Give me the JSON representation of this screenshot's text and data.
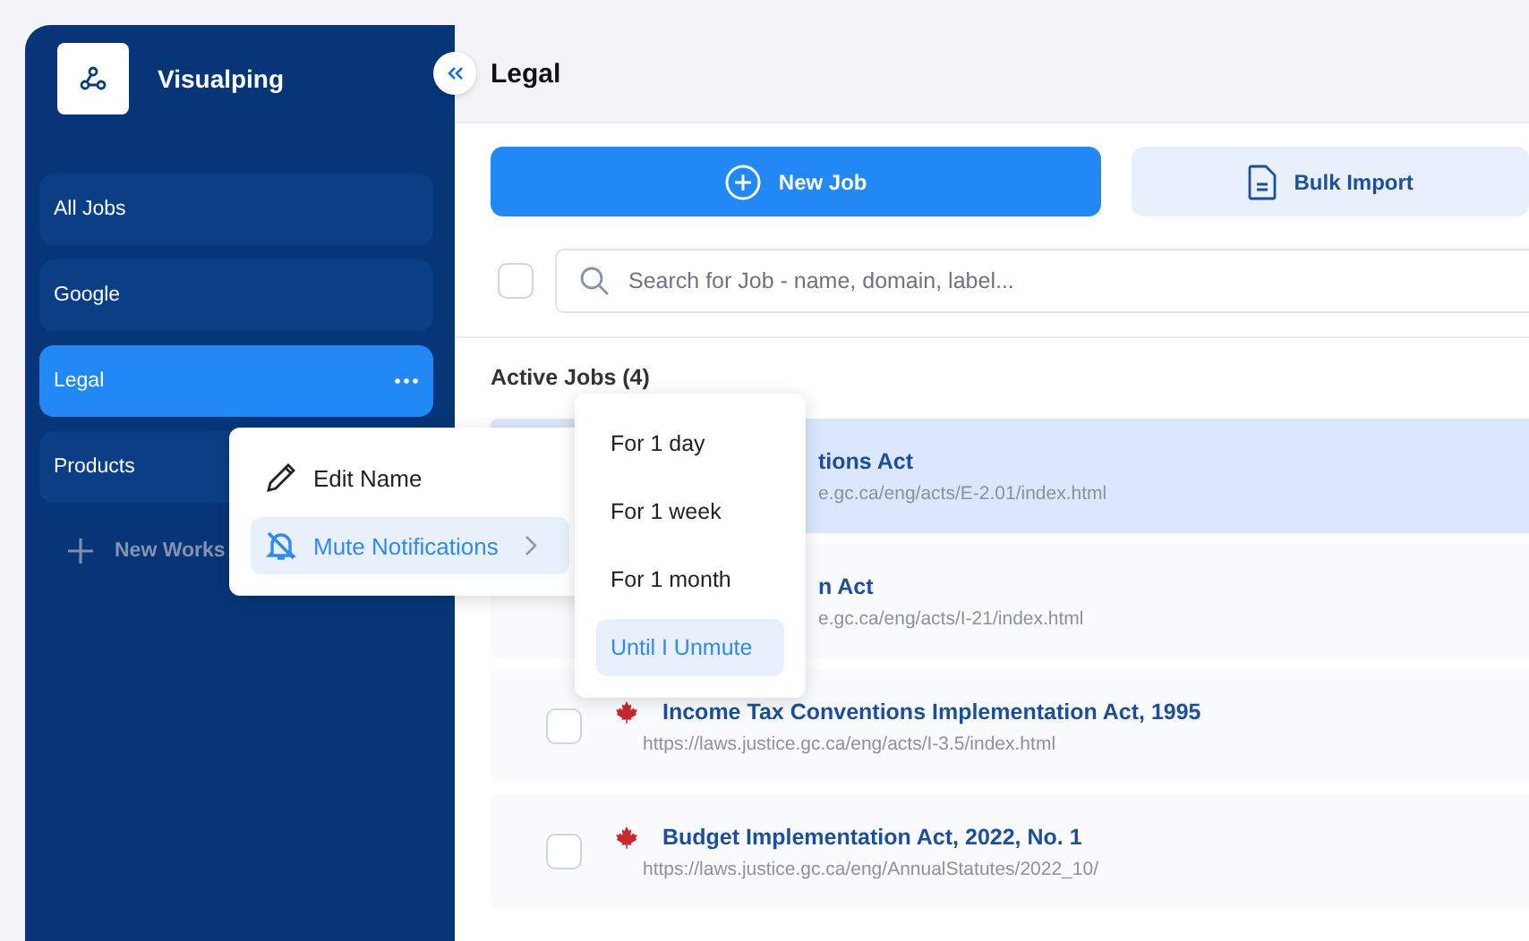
{
  "sidebar": {
    "brand": "Visualping",
    "items": [
      {
        "label": "All Jobs",
        "selected": false
      },
      {
        "label": "Google",
        "selected": false
      },
      {
        "label": "Legal",
        "selected": true
      },
      {
        "label": "Products",
        "selected": false
      }
    ],
    "new_workspace": "New Works"
  },
  "header": {
    "title": "Legal"
  },
  "buttons": {
    "new_job": "New Job",
    "bulk_import": "Bulk Import"
  },
  "search": {
    "placeholder": "Search for Job - name, domain, label...",
    "checked": false
  },
  "section_title": "Active Jobs (4)",
  "jobs": [
    {
      "title": "tions Act",
      "url": "e.gc.ca/eng/acts/E-2.01/index.html",
      "selected": true,
      "covered": true
    },
    {
      "title": "n Act",
      "url": "e.gc.ca/eng/acts/I-21/index.html",
      "selected": false,
      "covered": true
    },
    {
      "title": "Income Tax Conventions Implementation Act, 1995",
      "url": "https://laws.justice.gc.ca/eng/acts/I-3.5/index.html",
      "selected": false,
      "covered": false,
      "checked": false
    },
    {
      "title": "Budget Implementation Act, 2022, No. 1",
      "url": "https://laws.justice.gc.ca/eng/AnnualStatutes/2022_10/",
      "selected": false,
      "covered": false,
      "checked": false
    }
  ],
  "context_menu": {
    "items": [
      {
        "kind": "edit",
        "label": "Edit Name",
        "selected": false
      },
      {
        "kind": "mute",
        "label": "Mute Notifications",
        "selected": true
      }
    ]
  },
  "submenu": {
    "items": [
      {
        "label": "For 1 day",
        "selected": false
      },
      {
        "label": "For 1 week",
        "selected": false
      },
      {
        "label": "For 1 month",
        "selected": false
      },
      {
        "label": "Until I Unmute",
        "selected": true
      }
    ]
  }
}
